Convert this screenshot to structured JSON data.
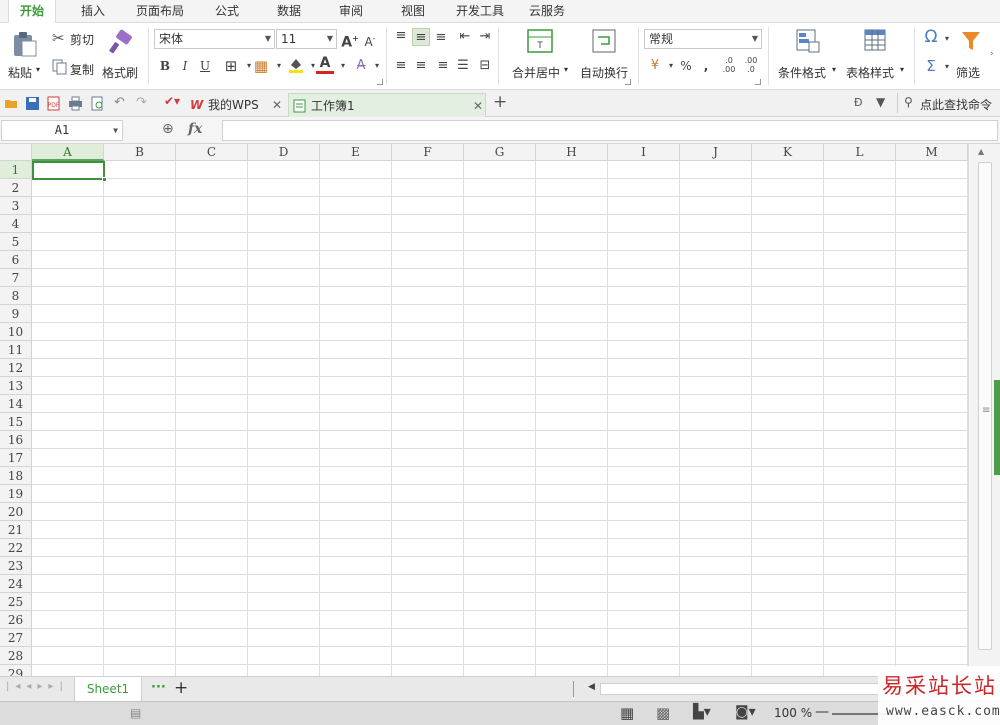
{
  "menu": {
    "tabs": [
      {
        "label": "开始",
        "active": true
      },
      {
        "label": "插入"
      },
      {
        "label": "页面布局"
      },
      {
        "label": "公式"
      },
      {
        "label": "数据"
      },
      {
        "label": "审阅"
      },
      {
        "label": "视图"
      },
      {
        "label": "开发工具"
      },
      {
        "label": "云服务"
      }
    ]
  },
  "ribbon": {
    "paste_label": "粘贴",
    "cut_label": "剪切",
    "copy_label": "复制",
    "format_painter_label": "格式刷",
    "font_name": "宋体",
    "font_size": "11",
    "bold": "B",
    "italic": "I",
    "underline": "U",
    "merge_center_label": "合并居中",
    "wrap_text_label": "自动换行",
    "number_format": "常规",
    "percent": "%",
    "comma": ",",
    "cond_format_label": "条件格式",
    "table_style_label": "表格样式",
    "filter_label": "筛选",
    "sum_symbol": "Σ",
    "omega_symbol": "Ω"
  },
  "quickbar": {
    "tabs": [
      {
        "label": "我的WPS"
      },
      {
        "label": "工作簿1",
        "active": true
      }
    ],
    "search_label": "点此查找命令"
  },
  "formula_bar": {
    "name_box": "A1",
    "fx_label": "fx",
    "formula": ""
  },
  "grid": {
    "columns": [
      "A",
      "B",
      "C",
      "D",
      "E",
      "F",
      "G",
      "H",
      "I",
      "J",
      "K",
      "L",
      "M"
    ],
    "rows": [
      "1",
      "2",
      "3",
      "4",
      "5",
      "6",
      "7",
      "8",
      "9",
      "10",
      "11",
      "12",
      "13",
      "14",
      "15",
      "16",
      "17",
      "18",
      "19",
      "20",
      "21",
      "22",
      "23",
      "24",
      "25",
      "26",
      "27",
      "28",
      "29"
    ],
    "selected_cell": "A1"
  },
  "sheets": {
    "tabs": [
      {
        "label": "Sheet1",
        "active": true
      }
    ]
  },
  "status": {
    "zoom": "100 %"
  },
  "watermark": {
    "title": "易采站长站",
    "url": "www.easck.com"
  },
  "colors": {
    "accent": "#3c9a3c",
    "grid_line": "#dedede",
    "header_bg": "#f3f3f3"
  }
}
